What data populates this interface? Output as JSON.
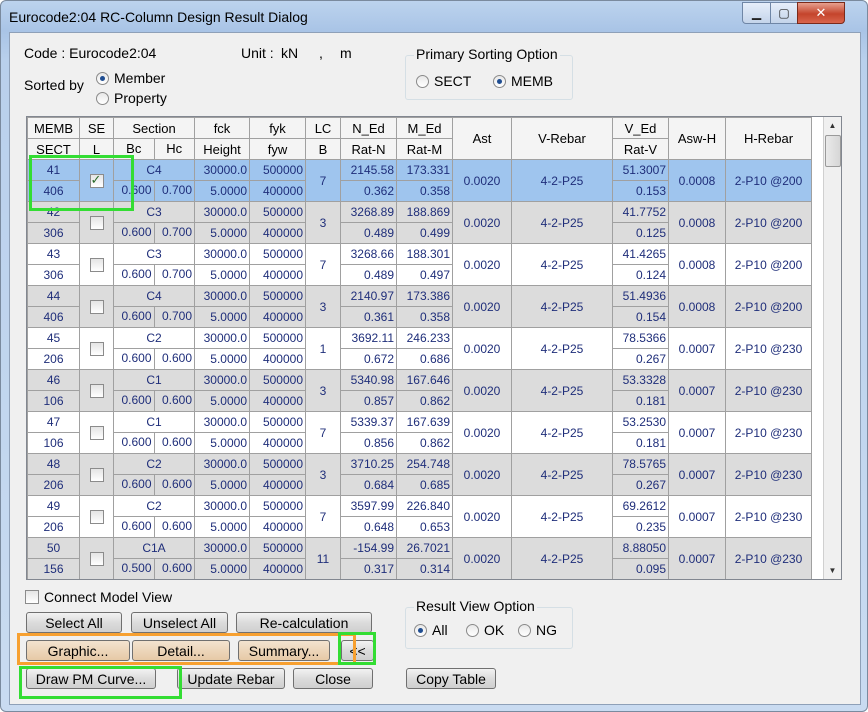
{
  "window": {
    "title": "Eurocode2:04 RC-Column Design Result Dialog"
  },
  "header": {
    "code_label": "Code : Eurocode2:04",
    "unit_label": "Unit :",
    "unit_force": "kN",
    "unit_sep": ",",
    "unit_length": "m",
    "sorted_by_label": "Sorted by",
    "sorted_by_options": [
      "Member",
      "Property"
    ],
    "sorted_by_selected": "Member",
    "primary_sort_title": "Primary Sorting Option",
    "primary_sort_options": [
      "SECT",
      "MEMB"
    ],
    "primary_sort_selected": "MEMB"
  },
  "table": {
    "headers_top": [
      "MEMB",
      "SE",
      "Section",
      "fck",
      "fyk",
      "LC",
      "N_Ed",
      "M_Ed",
      "Ast",
      "V-Rebar",
      "V_Ed",
      "Asw-H",
      "H-Rebar"
    ],
    "headers_bottom": [
      "SECT",
      "L",
      "Bc",
      "Hc",
      "Height",
      "fyw",
      "B",
      "Rat-N",
      "Rat-M",
      "Rat-V"
    ],
    "rows": [
      {
        "memb": "41",
        "sect": "406",
        "sel": true,
        "name": "C4",
        "bc": "0.600",
        "hc": "0.700",
        "fck": "30000.0",
        "height": "5.0000",
        "fyk": "500000",
        "fyw": "400000",
        "lcb": "7",
        "ned": "2145.58",
        "ratn": "0.362",
        "med": "173.331",
        "ratm": "0.358",
        "ast": "0.0020",
        "vrebar": "4-2-P25",
        "ved": "51.3007",
        "ratv": "0.153",
        "aswh": "0.0008",
        "hrebar": "2-P10 @200"
      },
      {
        "memb": "42",
        "sect": "306",
        "sel": false,
        "name": "C3",
        "bc": "0.600",
        "hc": "0.700",
        "fck": "30000.0",
        "height": "5.0000",
        "fyk": "500000",
        "fyw": "400000",
        "lcb": "3",
        "ned": "3268.89",
        "ratn": "0.489",
        "med": "188.869",
        "ratm": "0.499",
        "ast": "0.0020",
        "vrebar": "4-2-P25",
        "ved": "41.7752",
        "ratv": "0.125",
        "aswh": "0.0008",
        "hrebar": "2-P10 @200"
      },
      {
        "memb": "43",
        "sect": "306",
        "sel": false,
        "name": "C3",
        "bc": "0.600",
        "hc": "0.700",
        "fck": "30000.0",
        "height": "5.0000",
        "fyk": "500000",
        "fyw": "400000",
        "lcb": "7",
        "ned": "3268.66",
        "ratn": "0.489",
        "med": "188.301",
        "ratm": "0.497",
        "ast": "0.0020",
        "vrebar": "4-2-P25",
        "ved": "41.4265",
        "ratv": "0.124",
        "aswh": "0.0008",
        "hrebar": "2-P10 @200"
      },
      {
        "memb": "44",
        "sect": "406",
        "sel": false,
        "name": "C4",
        "bc": "0.600",
        "hc": "0.700",
        "fck": "30000.0",
        "height": "5.0000",
        "fyk": "500000",
        "fyw": "400000",
        "lcb": "3",
        "ned": "2140.97",
        "ratn": "0.361",
        "med": "173.386",
        "ratm": "0.358",
        "ast": "0.0020",
        "vrebar": "4-2-P25",
        "ved": "51.4936",
        "ratv": "0.154",
        "aswh": "0.0008",
        "hrebar": "2-P10 @200"
      },
      {
        "memb": "45",
        "sect": "206",
        "sel": false,
        "name": "C2",
        "bc": "0.600",
        "hc": "0.600",
        "fck": "30000.0",
        "height": "5.0000",
        "fyk": "500000",
        "fyw": "400000",
        "lcb": "1",
        "ned": "3692.11",
        "ratn": "0.672",
        "med": "246.233",
        "ratm": "0.686",
        "ast": "0.0020",
        "vrebar": "4-2-P25",
        "ved": "78.5366",
        "ratv": "0.267",
        "aswh": "0.0007",
        "hrebar": "2-P10 @230"
      },
      {
        "memb": "46",
        "sect": "106",
        "sel": false,
        "name": "C1",
        "bc": "0.600",
        "hc": "0.600",
        "fck": "30000.0",
        "height": "5.0000",
        "fyk": "500000",
        "fyw": "400000",
        "lcb": "3",
        "ned": "5340.98",
        "ratn": "0.857",
        "med": "167.646",
        "ratm": "0.862",
        "ast": "0.0020",
        "vrebar": "4-2-P25",
        "ved": "53.3328",
        "ratv": "0.181",
        "aswh": "0.0007",
        "hrebar": "2-P10 @230"
      },
      {
        "memb": "47",
        "sect": "106",
        "sel": false,
        "name": "C1",
        "bc": "0.600",
        "hc": "0.600",
        "fck": "30000.0",
        "height": "5.0000",
        "fyk": "500000",
        "fyw": "400000",
        "lcb": "7",
        "ned": "5339.37",
        "ratn": "0.856",
        "med": "167.639",
        "ratm": "0.862",
        "ast": "0.0020",
        "vrebar": "4-2-P25",
        "ved": "53.2530",
        "ratv": "0.181",
        "aswh": "0.0007",
        "hrebar": "2-P10 @230"
      },
      {
        "memb": "48",
        "sect": "206",
        "sel": false,
        "name": "C2",
        "bc": "0.600",
        "hc": "0.600",
        "fck": "30000.0",
        "height": "5.0000",
        "fyk": "500000",
        "fyw": "400000",
        "lcb": "3",
        "ned": "3710.25",
        "ratn": "0.684",
        "med": "254.748",
        "ratm": "0.685",
        "ast": "0.0020",
        "vrebar": "4-2-P25",
        "ved": "78.5765",
        "ratv": "0.267",
        "aswh": "0.0007",
        "hrebar": "2-P10 @230"
      },
      {
        "memb": "49",
        "sect": "206",
        "sel": false,
        "name": "C2",
        "bc": "0.600",
        "hc": "0.600",
        "fck": "30000.0",
        "height": "5.0000",
        "fyk": "500000",
        "fyw": "400000",
        "lcb": "7",
        "ned": "3597.99",
        "ratn": "0.648",
        "med": "226.840",
        "ratm": "0.653",
        "ast": "0.0020",
        "vrebar": "4-2-P25",
        "ved": "69.2612",
        "ratv": "0.235",
        "aswh": "0.0007",
        "hrebar": "2-P10 @230"
      },
      {
        "memb": "50",
        "sect": "156",
        "sel": false,
        "name": "C1A",
        "bc": "0.500",
        "hc": "0.600",
        "fck": "30000.0",
        "height": "5.0000",
        "fyk": "500000",
        "fyw": "400000",
        "lcb": "11",
        "ned": "-154.99",
        "ratn": "0.317",
        "med": "26.7021",
        "ratm": "0.314",
        "ast": "0.0020",
        "vrebar": "4-2-P25",
        "ved": "8.88050",
        "ratv": "0.095",
        "aswh": "0.0007",
        "hrebar": "2-P10 @230"
      }
    ]
  },
  "controls": {
    "connect_model_view": "Connect Model View",
    "select_all": "Select All",
    "unselect_all": "Unselect All",
    "recalculation": "Re-calculation",
    "graphic": "Graphic...",
    "detail": "Detail...",
    "summary": "Summary...",
    "collapse": "<<",
    "draw_pm_curve": "Draw PM Curve...",
    "update_rebar": "Update Rebar",
    "close": "Close",
    "copy_table": "Copy Table",
    "result_view_title": "Result View Option",
    "result_view_options": [
      "All",
      "OK",
      "NG"
    ],
    "result_view_selected": "All"
  },
  "colors": {
    "selected_row": "#9fc5ee",
    "alt_row": "#dcdcdc",
    "value_text": "#1f2e7a",
    "highlight_green": "#33dd33",
    "highlight_orange": "#f7a030"
  }
}
